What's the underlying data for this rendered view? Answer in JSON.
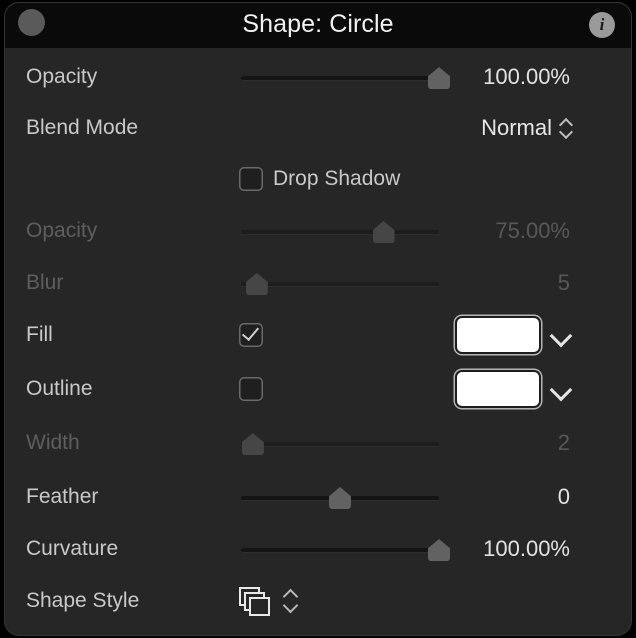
{
  "window": {
    "title": "Shape: Circle",
    "close_icon": "close-circle-icon",
    "info_icon": "info-icon",
    "info_glyph": "i",
    "background": "#262626",
    "titlebar_background": "#0a0a0a"
  },
  "rows": {
    "opacity": {
      "label": "Opacity",
      "value": "100.00%",
      "slider_percent": 100,
      "enabled": true
    },
    "blend_mode": {
      "label": "Blend Mode",
      "value": "Normal",
      "stepper_icon": "up-down-chevron-icon",
      "enabled": true
    },
    "drop_shadow": {
      "label": "Drop Shadow",
      "checked": false,
      "enabled": true
    },
    "shadow_opacity": {
      "label": "Opacity",
      "value": "75.00%",
      "slider_percent": 72,
      "enabled": false
    },
    "blur": {
      "label": "Blur",
      "value": "5",
      "slider_percent": 8,
      "enabled": false
    },
    "fill": {
      "label": "Fill",
      "checked": true,
      "color": "#ffffff",
      "chevron_icon": "chevron-down-icon",
      "enabled": true
    },
    "outline": {
      "label": "Outline",
      "checked": false,
      "color": "#ffffff",
      "chevron_icon": "chevron-down-icon",
      "enabled": true
    },
    "width": {
      "label": "Width",
      "value": "2",
      "slider_percent": 6,
      "enabled": false
    },
    "feather": {
      "label": "Feather",
      "value": "0",
      "slider_percent": 50,
      "enabled": true
    },
    "curvature": {
      "label": "Curvature",
      "value": "100.00%",
      "slider_percent": 100,
      "enabled": true
    },
    "shape_style": {
      "label": "Shape Style",
      "icon": "layered-shapes-icon",
      "stepper_icon": "up-down-chevron-icon",
      "enabled": true
    }
  }
}
